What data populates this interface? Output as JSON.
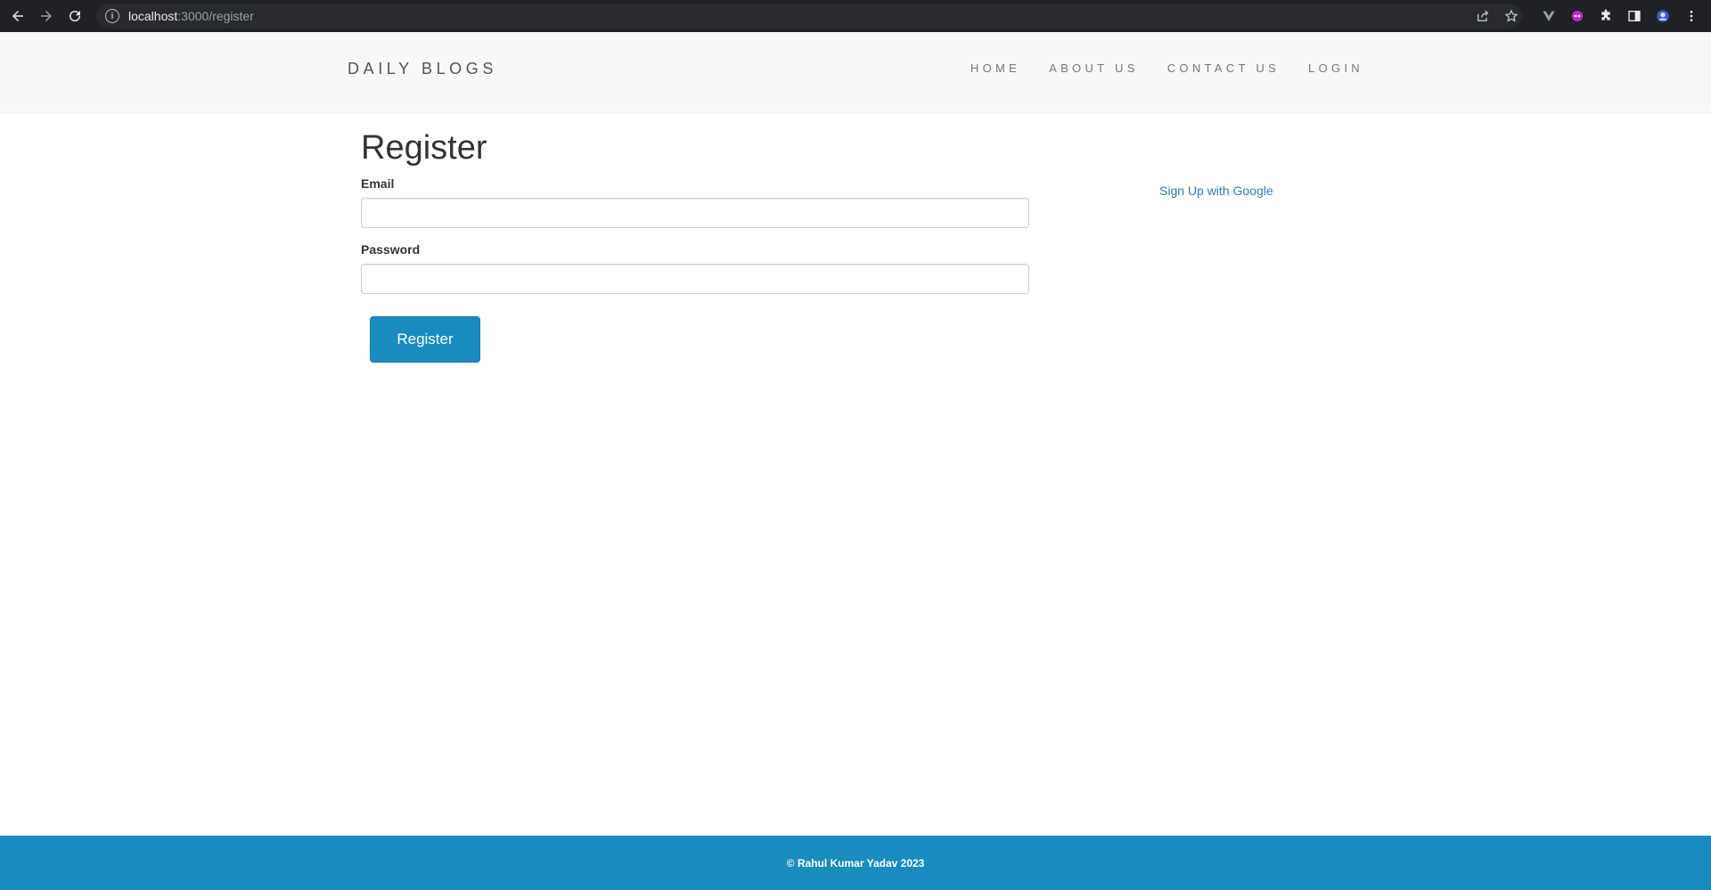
{
  "browser": {
    "url_host": "localhost",
    "url_rest": ":3000/register",
    "info_glyph": "i",
    "icons": [
      "back-icon",
      "forward-icon",
      "reload-icon",
      "info-icon",
      "share-icon",
      "star-icon",
      "vuejs-icon",
      "extension-purple-icon",
      "puzzle-icon",
      "sidepanel-icon",
      "profile-avatar",
      "kebab-menu-icon"
    ]
  },
  "header": {
    "brand": "DAILY BLOGS",
    "nav": [
      "HOME",
      "ABOUT US",
      "CONTACT US",
      "LOGIN"
    ]
  },
  "form": {
    "title": "Register",
    "email_label": "Email",
    "email_value": "",
    "password_label": "Password",
    "password_value": "",
    "submit_label": "Register"
  },
  "sidebar": {
    "google_link": "Sign Up with Google"
  },
  "footer": {
    "text": "© Rahul Kumar Yadav 2023"
  },
  "colors": {
    "accent": "#1a8bbf",
    "link": "#337ab7",
    "header_bg": "#f8f8f8",
    "chrome_bg": "#202124"
  }
}
